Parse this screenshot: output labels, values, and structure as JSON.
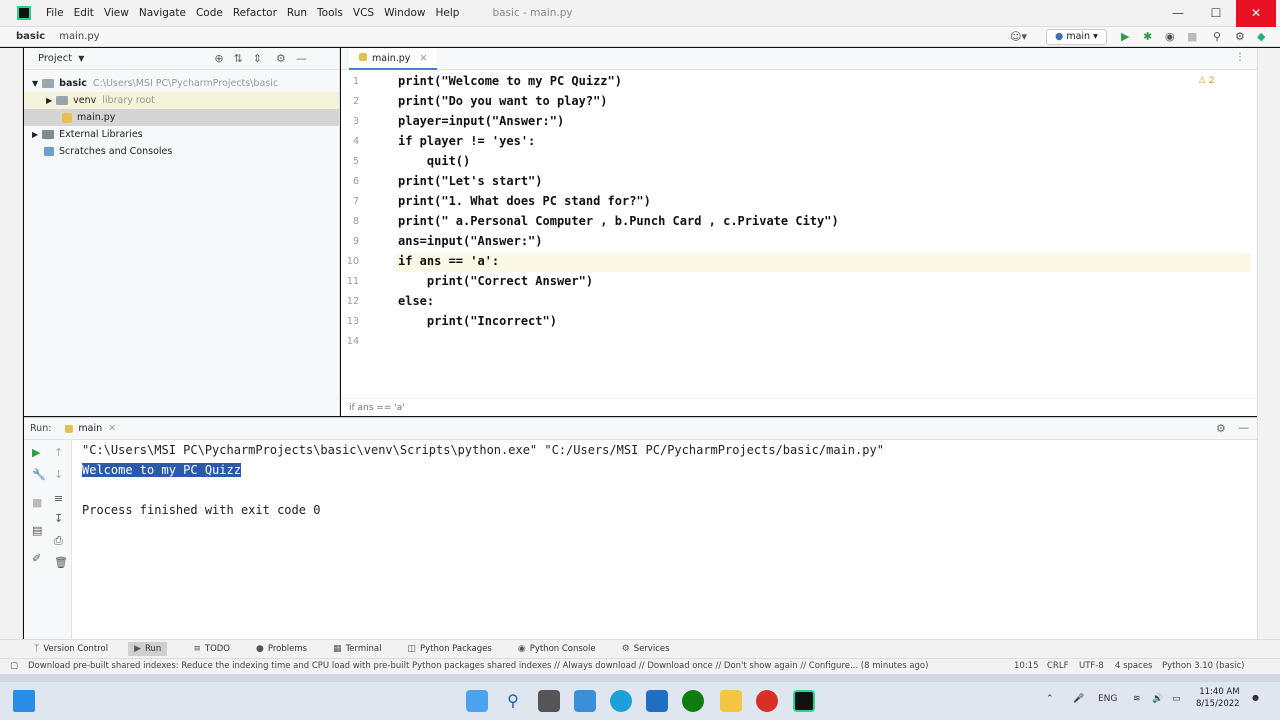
{
  "titlebar": {
    "menu": [
      "File",
      "Edit",
      "View",
      "Navigate",
      "Code",
      "Refactor",
      "Run",
      "Tools",
      "VCS",
      "Window",
      "Help"
    ],
    "window_title": "basic - main.py"
  },
  "navbar": {
    "project": "basic",
    "file": "main.py",
    "run_config": "main"
  },
  "project_panel": {
    "title": "Project",
    "root": "basic",
    "root_path": "C:\\Users\\MSI PC\\PycharmProjects\\basic",
    "venv": "venv",
    "venv_note": "library root",
    "file": "main.py",
    "external": "External Libraries",
    "scratches": "Scratches and Consoles"
  },
  "editor": {
    "tab": "main.py",
    "warnings": "⚠ 2",
    "lines": [
      "print(\"Welcome to my PC Quizz\")",
      "print(\"Do you want to play?\")",
      "player=input(\"Answer:\")",
      "if player != 'yes':",
      "    quit()",
      "print(\"Let's start\")",
      "print(\"1. What does PC stand for?\")",
      "print(\" a.Personal Computer , b.Punch Card , c.Private City\")",
      "ans=input(\"Answer:\")",
      "if ans == 'a':",
      "    print(\"Correct Answer\")",
      "else:",
      "    print(\"Incorrect\")",
      ""
    ],
    "line_numbers": [
      "1",
      "2",
      "3",
      "4",
      "5",
      "6",
      "7",
      "8",
      "9",
      "10",
      "11",
      "12",
      "13",
      "14"
    ],
    "breadcrumb": "if ans == 'a'"
  },
  "run_panel": {
    "label": "Run:",
    "tab": "main",
    "command": "\"C:\\Users\\MSI PC\\PycharmProjects\\basic\\venv\\Scripts\\python.exe\" \"C:/Users/MSI PC/PycharmProjects/basic/main.py\"",
    "output": "Welcome to my PC Quizz",
    "exit": "Process finished with exit code 0"
  },
  "tool_tabs": [
    "Version Control",
    "Run",
    "TODO",
    "Problems",
    "Terminal",
    "Python Packages",
    "Python Console",
    "Services"
  ],
  "statusbar": {
    "message": "Download pre-built shared indexes: Reduce the indexing time and CPU load with pre-built Python packages shared indexes // Always download // Download once // Don't show again // Configure... (8 minutes ago)",
    "position": "10:15",
    "line_sep": "CRLF",
    "encoding": "UTF-8",
    "indent": "4 spaces",
    "interpreter": "Python 3.10 (basic)"
  },
  "taskbar": {
    "lang": "ENG",
    "time": "11:40 AM",
    "date": "8/15/2022"
  },
  "colors": {
    "selection": "#2a5aa8",
    "current_line": "#fbf9e6",
    "accent": "#4083c9"
  }
}
